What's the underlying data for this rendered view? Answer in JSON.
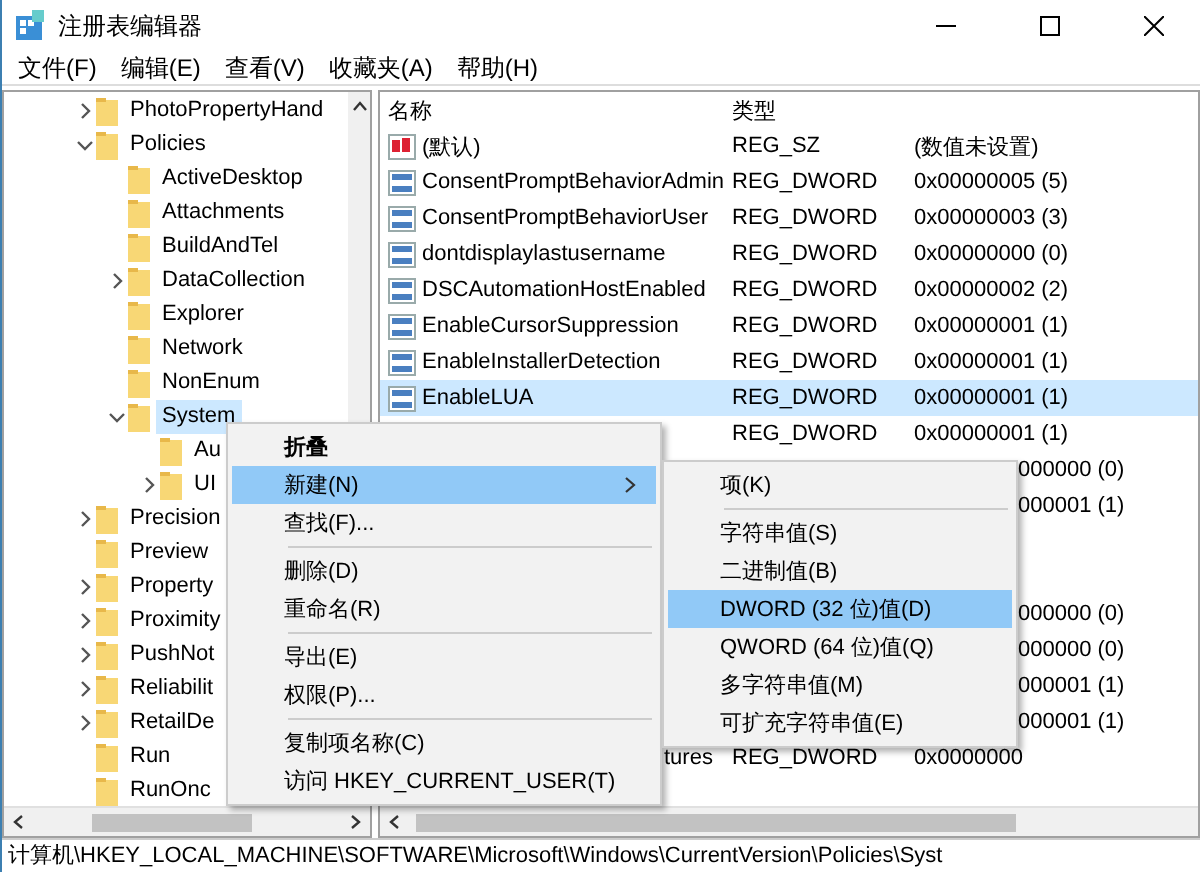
{
  "window": {
    "title": "注册表编辑器"
  },
  "menu_bar": [
    "文件(F)",
    "编辑(E)",
    "查看(V)",
    "收藏夹(A)",
    "帮助(H)"
  ],
  "tree": [
    {
      "label": "PhotoPropertyHand",
      "expanded": false,
      "selected": false
    },
    {
      "label": "Policies",
      "expanded": true,
      "selected": false,
      "children": [
        {
          "label": "ActiveDesktop",
          "selected": false
        },
        {
          "label": "Attachments",
          "selected": false
        },
        {
          "label": "BuildAndTel",
          "selected": false
        },
        {
          "label": "DataCollection",
          "expanded": false,
          "selected": false
        },
        {
          "label": "Explorer",
          "selected": false
        },
        {
          "label": "Network",
          "selected": false
        },
        {
          "label": "NonEnum",
          "selected": false
        },
        {
          "label": "System",
          "expanded": true,
          "selected": true,
          "children": [
            {
              "label": "Au",
              "selected": false
            },
            {
              "label": "UI",
              "expanded": false,
              "selected": false
            }
          ]
        }
      ]
    },
    {
      "label": "Precision",
      "expanded": false,
      "selected": false
    },
    {
      "label": "Preview",
      "selected": false
    },
    {
      "label": "Property",
      "expanded": false,
      "selected": false
    },
    {
      "label": "Proximity",
      "expanded": false,
      "selected": false
    },
    {
      "label": "PushNot",
      "expanded": false,
      "selected": false
    },
    {
      "label": "Reliabilit",
      "expanded": false,
      "selected": false
    },
    {
      "label": "RetailDe",
      "expanded": false,
      "selected": false
    },
    {
      "label": "Run",
      "selected": false
    },
    {
      "label": "RunOnc",
      "selected": false
    }
  ],
  "values": {
    "columns": [
      "名称",
      "类型"
    ],
    "rows": [
      {
        "kind": "string",
        "name": "(默认)",
        "type": "REG_SZ",
        "data": "(数值未设置)",
        "selected": false
      },
      {
        "kind": "dword",
        "name": "ConsentPromptBehaviorAdmin",
        "type": "REG_DWORD",
        "data": "0x00000005 (5)",
        "selected": false
      },
      {
        "kind": "dword",
        "name": "ConsentPromptBehaviorUser",
        "type": "REG_DWORD",
        "data": "0x00000003 (3)",
        "selected": false
      },
      {
        "kind": "dword",
        "name": "dontdisplaylastusername",
        "type": "REG_DWORD",
        "data": "0x00000000 (0)",
        "selected": false
      },
      {
        "kind": "dword",
        "name": "DSCAutomationHostEnabled",
        "type": "REG_DWORD",
        "data": "0x00000002 (2)",
        "selected": false
      },
      {
        "kind": "dword",
        "name": "EnableCursorSuppression",
        "type": "REG_DWORD",
        "data": "0x00000001 (1)",
        "selected": false
      },
      {
        "kind": "dword",
        "name": "EnableInstallerDetection",
        "type": "REG_DWORD",
        "data": "0x00000001 (1)",
        "selected": false
      },
      {
        "kind": "dword",
        "name": "EnableLUA",
        "type": "REG_DWORD",
        "data": "0x00000001 (1)",
        "selected": true
      },
      {
        "kind": "covered-left",
        "type": "REG_DWORD",
        "data": "0x00000001 (1)",
        "selected": false
      },
      {
        "kind": "covered-mid",
        "data": "000000 (0)",
        "selected": false
      },
      {
        "kind": "covered-mid",
        "data": "000001 (1)",
        "selected": false
      },
      {
        "kind": "covered-mid",
        "selected": false
      },
      {
        "kind": "covered-mid",
        "selected": false
      },
      {
        "kind": "covered-mid",
        "data": "000000 (0)",
        "selected": false
      },
      {
        "kind": "covered-mid",
        "data": "000000 (0)",
        "selected": false
      },
      {
        "kind": "covered-mid",
        "data": "000001 (1)",
        "selected": false
      },
      {
        "kind": "covered-mid",
        "data": "000001 (1)",
        "selected": false
      },
      {
        "kind": "covered-left",
        "name": "tures",
        "type": "REG_DWORD",
        "data": "0x0000000",
        "selected": false
      }
    ]
  },
  "context_menu": {
    "groups": [
      [
        {
          "label": "折叠",
          "default": true,
          "submenu": false,
          "selected": false
        },
        {
          "label": "新建(N)",
          "default": false,
          "submenu": true,
          "selected": true
        },
        {
          "label": "查找(F)...",
          "default": false,
          "submenu": false,
          "selected": false
        }
      ],
      [
        {
          "label": "删除(D)",
          "default": false,
          "submenu": false,
          "selected": false
        },
        {
          "label": "重命名(R)",
          "default": false,
          "submenu": false,
          "selected": false
        }
      ],
      [
        {
          "label": "导出(E)",
          "default": false,
          "submenu": false,
          "selected": false
        },
        {
          "label": "权限(P)...",
          "default": false,
          "submenu": false,
          "selected": false
        }
      ],
      [
        {
          "label": "复制项名称(C)",
          "default": false,
          "submenu": false,
          "selected": false
        },
        {
          "label": "访问 HKEY_CURRENT_USER(T)",
          "default": false,
          "submenu": false,
          "selected": false
        }
      ]
    ]
  },
  "submenu": {
    "groups": [
      [
        {
          "label": "项(K)",
          "selected": false
        }
      ],
      [
        {
          "label": "字符串值(S)",
          "selected": false
        },
        {
          "label": "二进制值(B)",
          "selected": false
        },
        {
          "label": "DWORD (32 位)值(D)",
          "selected": true
        },
        {
          "label": "QWORD (64 位)值(Q)",
          "selected": false
        },
        {
          "label": "多字符串值(M)",
          "selected": false
        },
        {
          "label": "可扩充字符串值(E)",
          "selected": false
        }
      ]
    ]
  },
  "status_bar": "计算机\\HKEY_LOCAL_MACHINE\\SOFTWARE\\Microsoft\\Windows\\CurrentVersion\\Policies\\Syst"
}
